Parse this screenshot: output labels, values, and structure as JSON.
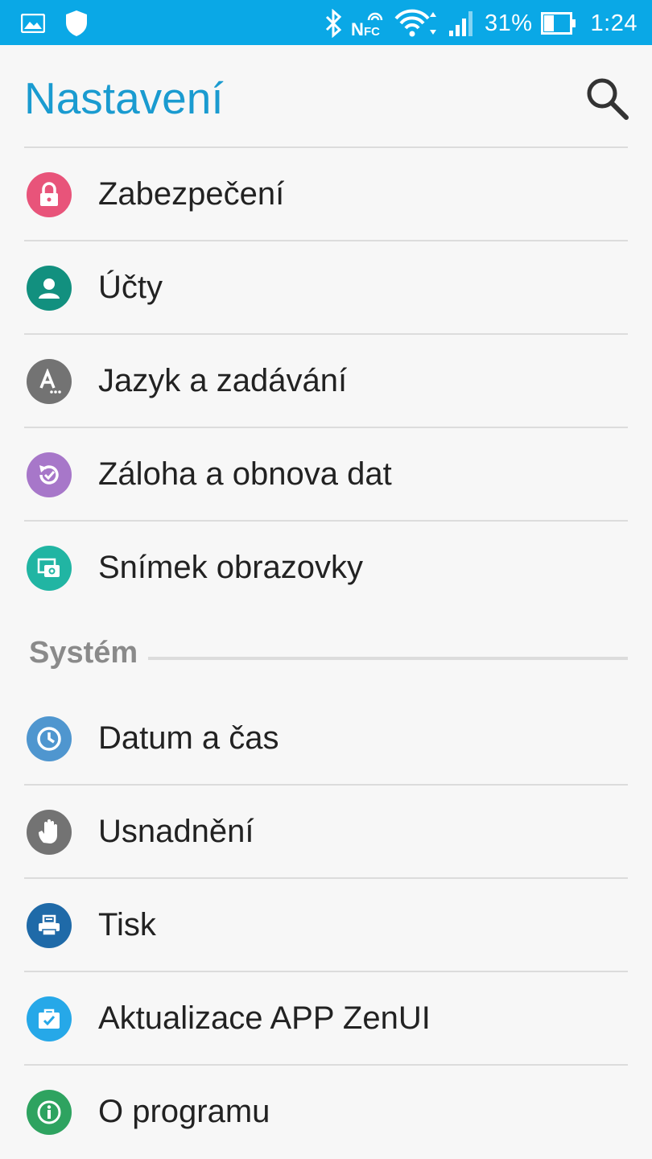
{
  "status_bar": {
    "battery_percent": "31%",
    "time": "1:24",
    "icons": [
      "image-notification-icon",
      "shield-icon",
      "bluetooth-icon",
      "nfc-icon",
      "wifi-icon",
      "signal-icon",
      "battery-icon"
    ],
    "nfc_label": "NFC"
  },
  "header": {
    "title": "Nastavení",
    "search_icon": "search-icon"
  },
  "groups": [
    {
      "items": [
        {
          "label": "Zabezpečení",
          "icon": "lock-icon",
          "color": "#e8547a"
        },
        {
          "label": "Účty",
          "icon": "account-icon",
          "color": "#12907f"
        },
        {
          "label": "Jazyk a zadávání",
          "icon": "language-icon",
          "color": "#737373"
        },
        {
          "label": "Záloha a obnova dat",
          "icon": "backup-icon",
          "color": "#a777c9"
        },
        {
          "label": "Snímek obrazovky",
          "icon": "screenshot-icon",
          "color": "#21b5a3"
        }
      ]
    },
    {
      "title": "Systém",
      "items": [
        {
          "label": "Datum a čas",
          "icon": "clock-icon",
          "color": "#4f96cf"
        },
        {
          "label": "Usnadnění",
          "icon": "hand-icon",
          "color": "#737373"
        },
        {
          "label": "Tisk",
          "icon": "print-icon",
          "color": "#1f6aa8"
        },
        {
          "label": "Aktualizace APP ZenUI",
          "icon": "update-icon",
          "color": "#26a8e8"
        },
        {
          "label": "O programu",
          "icon": "info-icon",
          "color": "#2ea360"
        }
      ]
    }
  ]
}
